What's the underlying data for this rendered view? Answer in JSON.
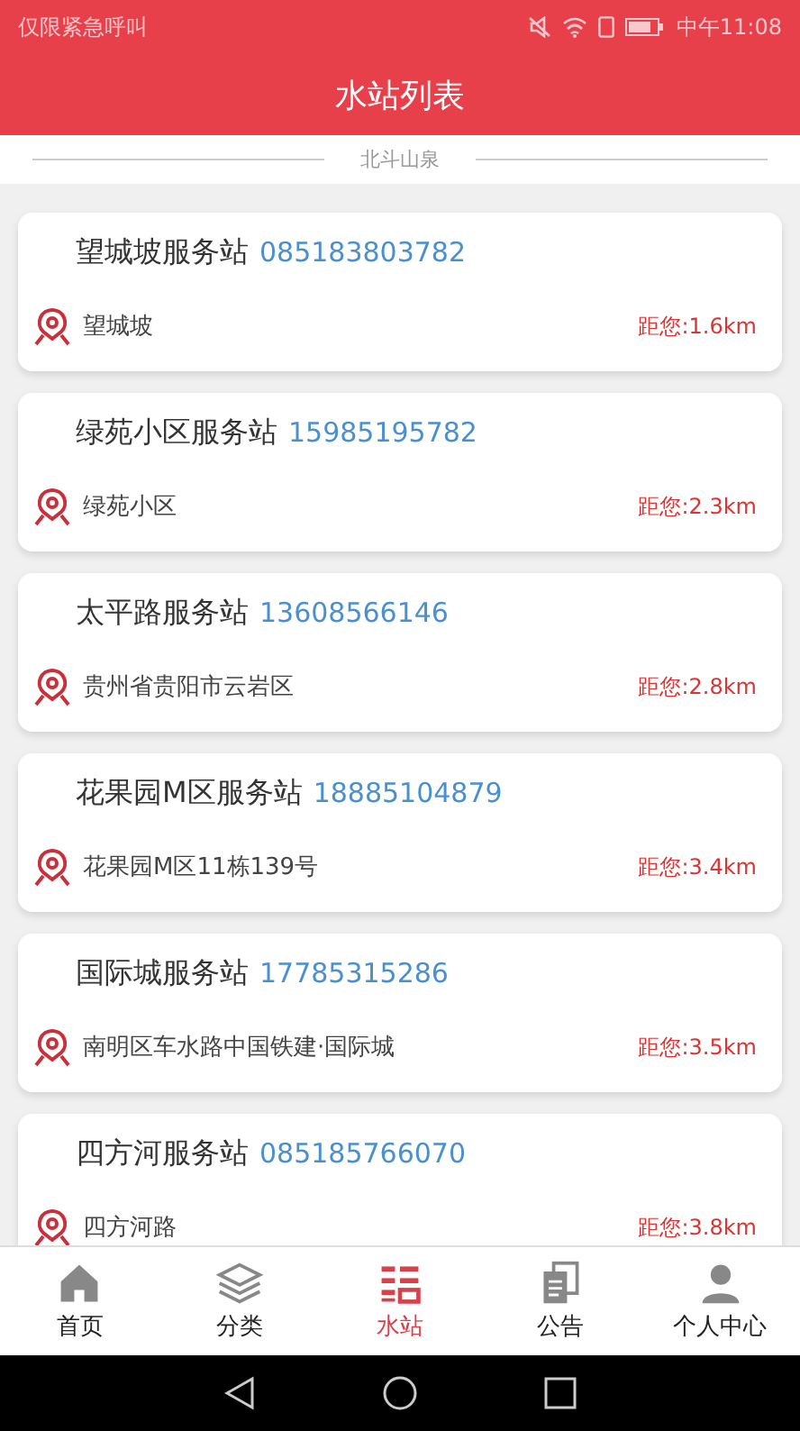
{
  "status_bar": {
    "carrier": "仅限紧急呼叫",
    "time": "中午11:08"
  },
  "header": {
    "title": "水站列表"
  },
  "section_label": "北斗山泉",
  "stations": [
    {
      "name": "望城坡服务站",
      "phone": "085183803782",
      "address": "望城坡",
      "distance": "距您:1.6km"
    },
    {
      "name": "绿苑小区服务站",
      "phone": "15985195782",
      "address": "绿苑小区",
      "distance": "距您:2.3km"
    },
    {
      "name": "太平路服务站",
      "phone": "13608566146",
      "address": "贵州省贵阳市云岩区",
      "distance": "距您:2.8km"
    },
    {
      "name": "花果园M区服务站",
      "phone": "18885104879",
      "address": "花果园M区11栋139号",
      "distance": "距您:3.4km"
    },
    {
      "name": "国际城服务站",
      "phone": "17785315286",
      "address": "南明区车水路中国铁建·国际城",
      "distance": "距您:3.5km"
    },
    {
      "name": "四方河服务站",
      "phone": "085185766070",
      "address": "四方河路",
      "distance": "距您:3.8km"
    }
  ],
  "tab_bar": [
    {
      "label": "首页",
      "kind": "home",
      "selected": false
    },
    {
      "label": "分类",
      "kind": "layers",
      "selected": false
    },
    {
      "label": "水站",
      "kind": "list",
      "selected": true
    },
    {
      "label": "公告",
      "kind": "docs",
      "selected": false
    },
    {
      "label": "个人中心",
      "kind": "person",
      "selected": false
    }
  ]
}
